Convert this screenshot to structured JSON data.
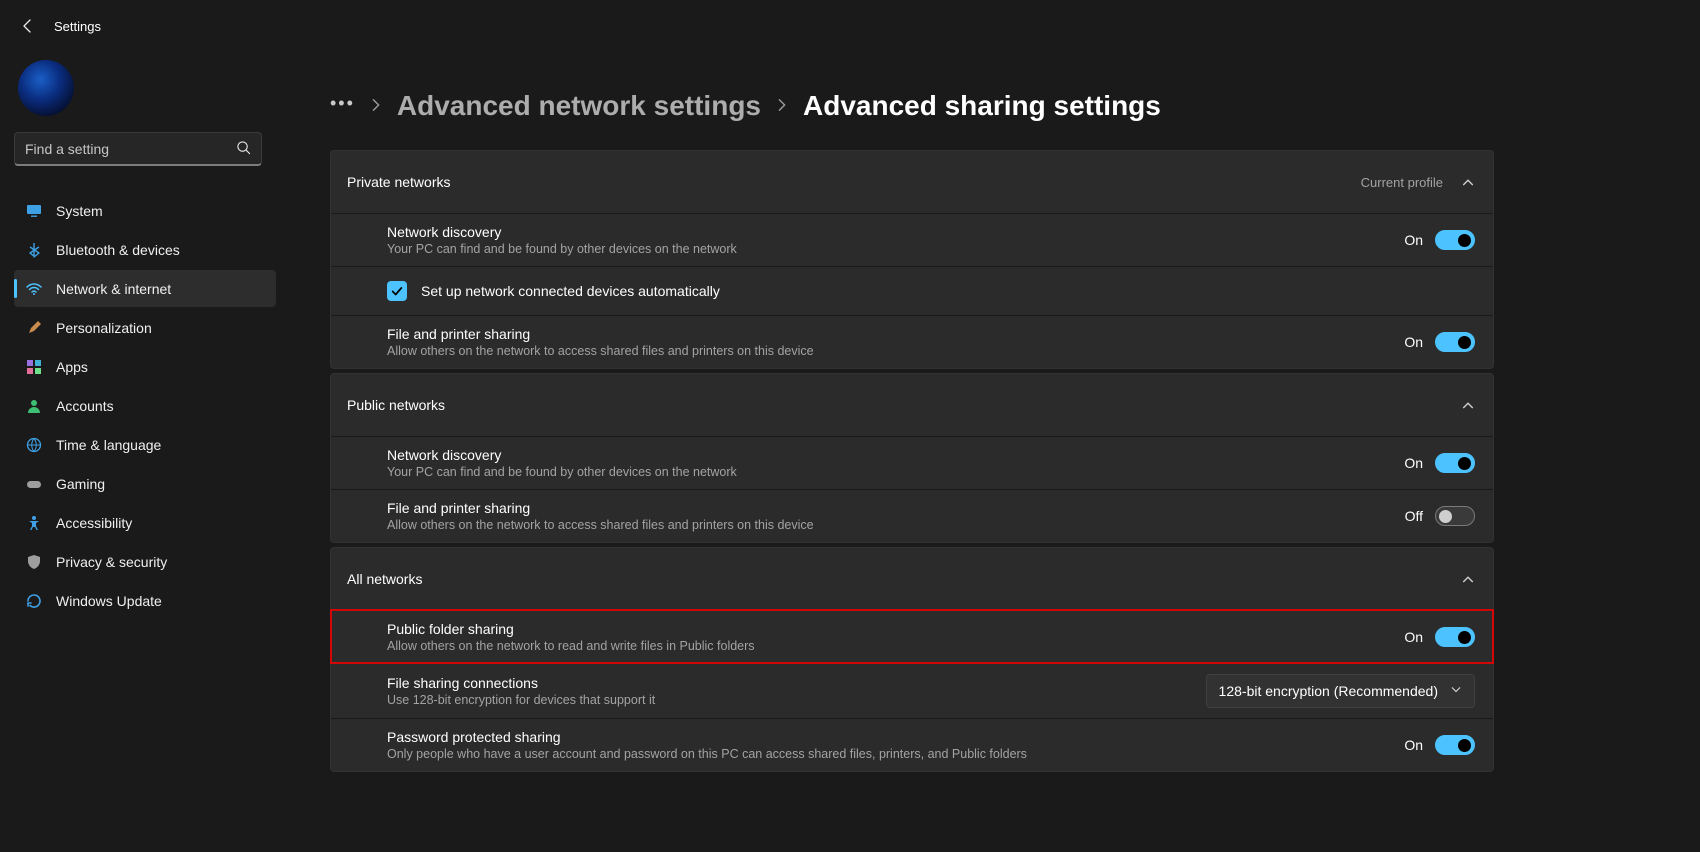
{
  "app_title": "Settings",
  "search": {
    "placeholder": "Find a setting"
  },
  "sidebar": {
    "items": [
      {
        "label": "System",
        "icon": "monitor-icon"
      },
      {
        "label": "Bluetooth & devices",
        "icon": "bluetooth-icon"
      },
      {
        "label": "Network & internet",
        "icon": "wifi-icon",
        "active": true
      },
      {
        "label": "Personalization",
        "icon": "brush-icon"
      },
      {
        "label": "Apps",
        "icon": "apps-icon"
      },
      {
        "label": "Accounts",
        "icon": "person-icon"
      },
      {
        "label": "Time & language",
        "icon": "globe-clock-icon"
      },
      {
        "label": "Gaming",
        "icon": "gamepad-icon"
      },
      {
        "label": "Accessibility",
        "icon": "accessibility-icon"
      },
      {
        "label": "Privacy & security",
        "icon": "shield-icon"
      },
      {
        "label": "Windows Update",
        "icon": "update-icon"
      }
    ]
  },
  "breadcrumbs": {
    "parent": "Advanced network settings",
    "current": "Advanced sharing settings"
  },
  "sections": {
    "private": {
      "title": "Private networks",
      "badge": "Current profile",
      "rows": {
        "nd": {
          "title": "Network discovery",
          "desc": "Your PC can find and be found by other devices on the network",
          "state": "On"
        },
        "auto": {
          "label": "Set up network connected devices automatically"
        },
        "fps": {
          "title": "File and printer sharing",
          "desc": "Allow others on the network to access shared files and printers on this device",
          "state": "On"
        }
      }
    },
    "public": {
      "title": "Public networks",
      "rows": {
        "nd": {
          "title": "Network discovery",
          "desc": "Your PC can find and be found by other devices on the network",
          "state": "On"
        },
        "fps": {
          "title": "File and printer sharing",
          "desc": "Allow others on the network to access shared files and printers on this device",
          "state": "Off"
        }
      }
    },
    "all": {
      "title": "All networks",
      "rows": {
        "pfs": {
          "title": "Public folder sharing",
          "desc": "Allow others on the network to read and write files in Public folders",
          "state": "On"
        },
        "fsc": {
          "title": "File sharing connections",
          "desc": "Use 128-bit encryption for devices that support it",
          "value": "128-bit encryption (Recommended)"
        },
        "pps": {
          "title": "Password protected sharing",
          "desc": "Only people who have a user account and password on this PC can access shared files, printers, and Public folders",
          "state": "On"
        }
      }
    }
  }
}
